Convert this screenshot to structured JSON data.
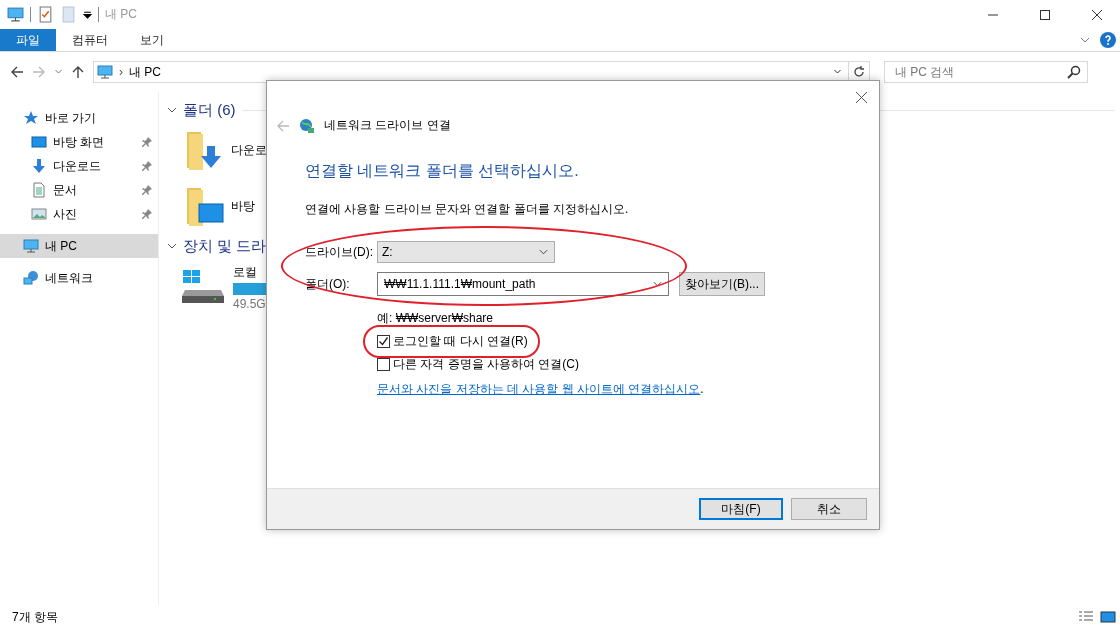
{
  "window": {
    "title": "내 PC",
    "ribbon_tabs": [
      {
        "label": "파일",
        "selected": true
      },
      {
        "label": "컴퓨터",
        "selected": false
      },
      {
        "label": "보기",
        "selected": false
      }
    ]
  },
  "address_bar": {
    "separator": "›",
    "path": "내 PC",
    "search_placeholder": "내 PC 검색"
  },
  "sidebar": {
    "items": [
      {
        "label": "바로 가기",
        "pinned": false,
        "selected": false
      },
      {
        "label": "바탕 화면",
        "pinned": true,
        "selected": false
      },
      {
        "label": "다운로드",
        "pinned": true,
        "selected": false
      },
      {
        "label": "문서",
        "pinned": true,
        "selected": false
      },
      {
        "label": "사진",
        "pinned": true,
        "selected": false
      },
      {
        "label": "내 PC",
        "pinned": false,
        "selected": true
      },
      {
        "label": "네트워크",
        "pinned": false,
        "selected": false
      }
    ]
  },
  "content": {
    "folders_header": "폴더 (6)",
    "folders": [
      {
        "name": "다운로"
      },
      {
        "name": "바탕"
      }
    ],
    "devices_header": "장치 및 드라",
    "drives": [
      {
        "name": "로컬",
        "size": "49.5G"
      }
    ]
  },
  "status_bar": {
    "count": "7개 항목"
  },
  "dialog": {
    "title": "네트워크 드라이브 연결",
    "heading": "연결할 네트워크 폴더를 선택하십시오.",
    "instruction": "연결에 사용할 드라이브 문자와 연결할 폴더를 지정하십시오.",
    "fields_highlighted": true,
    "drive_label": "드라이브(D):",
    "drive_value": "Z:",
    "folder_label": "폴더(O):",
    "folder_value": "₩₩11.1.111.1₩mount_path",
    "browse_button": "찾아보기(B)...",
    "example": "예: ₩₩server₩share",
    "options": [
      {
        "label": "로그인할 때 다시 연결(R)",
        "checked": true,
        "highlighted": true
      },
      {
        "label": "다른 자격 증명을 사용하여 연결(C)",
        "checked": false,
        "highlighted": false
      }
    ],
    "link": "문서와 사진을 저장하는 데 사용할 웹 사이트에 연결하십시오",
    "link_suffix": ".",
    "buttons": [
      {
        "label": "마침(F)",
        "default": true
      },
      {
        "label": "취소",
        "default": false
      }
    ]
  }
}
